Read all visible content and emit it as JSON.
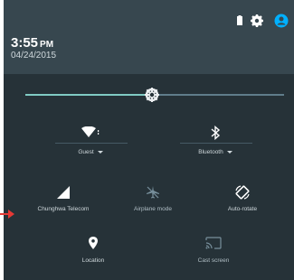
{
  "status": {
    "time": "3:55",
    "ampm": "PM",
    "date": "04/24/2015"
  },
  "brightness": {
    "level": 0.49
  },
  "tiles": {
    "wifi": {
      "label": "Guest"
    },
    "bluetooth": {
      "label": "Bluetooth"
    },
    "cellular": {
      "label": "Chunghwa Telecom"
    },
    "airplane": {
      "label": "Airplane mode"
    },
    "autorotate": {
      "label": "Auto-rotate"
    },
    "location": {
      "label": "Location"
    },
    "cast": {
      "label": "Cast screen"
    }
  },
  "colors": {
    "panel": "#263238",
    "header": "#37474f",
    "accent": "#80cbc4",
    "user_icon": "#00b0ff",
    "arrow": "#e53935"
  }
}
